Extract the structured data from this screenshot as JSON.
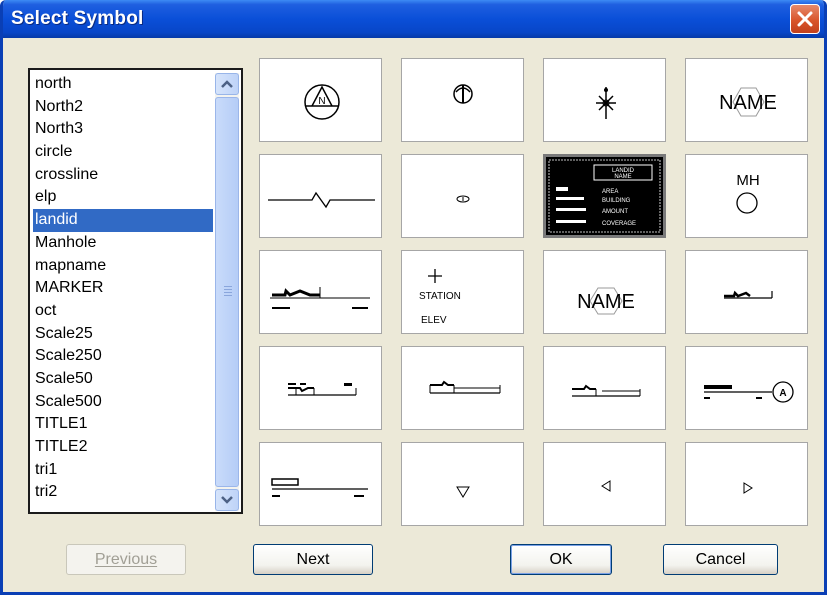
{
  "window": {
    "title": "Select Symbol",
    "close_icon": "close-x-icon",
    "accent": "#0a4fd8",
    "close_color": "#d9552b"
  },
  "symbol_list": {
    "selected": "landid",
    "selected_color": "#316ac5",
    "items": [
      "north",
      "North2",
      "North3",
      "circle",
      "crossline",
      "elp",
      "landid",
      "Manhole",
      "mapname",
      "MARKER",
      "oct",
      "Scale25",
      "Scale250",
      "Scale50",
      "Scale500",
      "TITLE1",
      "TITLE2",
      "tri1",
      "tri2"
    ]
  },
  "symbols": {
    "name_text": "NAME",
    "mh_text": "MH",
    "station_text": "STATION",
    "elev_text": "ELEV",
    "landid_title": "LANDID",
    "landid_name": "NAME",
    "landid_rows": [
      "AREA",
      "BUILDING",
      "AMOUNT",
      "COVERAGE"
    ],
    "marker_letter": "A",
    "north_letter": "N"
  },
  "buttons": {
    "previous": "Previous",
    "next": "Next",
    "ok": "OK",
    "cancel": "Cancel"
  }
}
